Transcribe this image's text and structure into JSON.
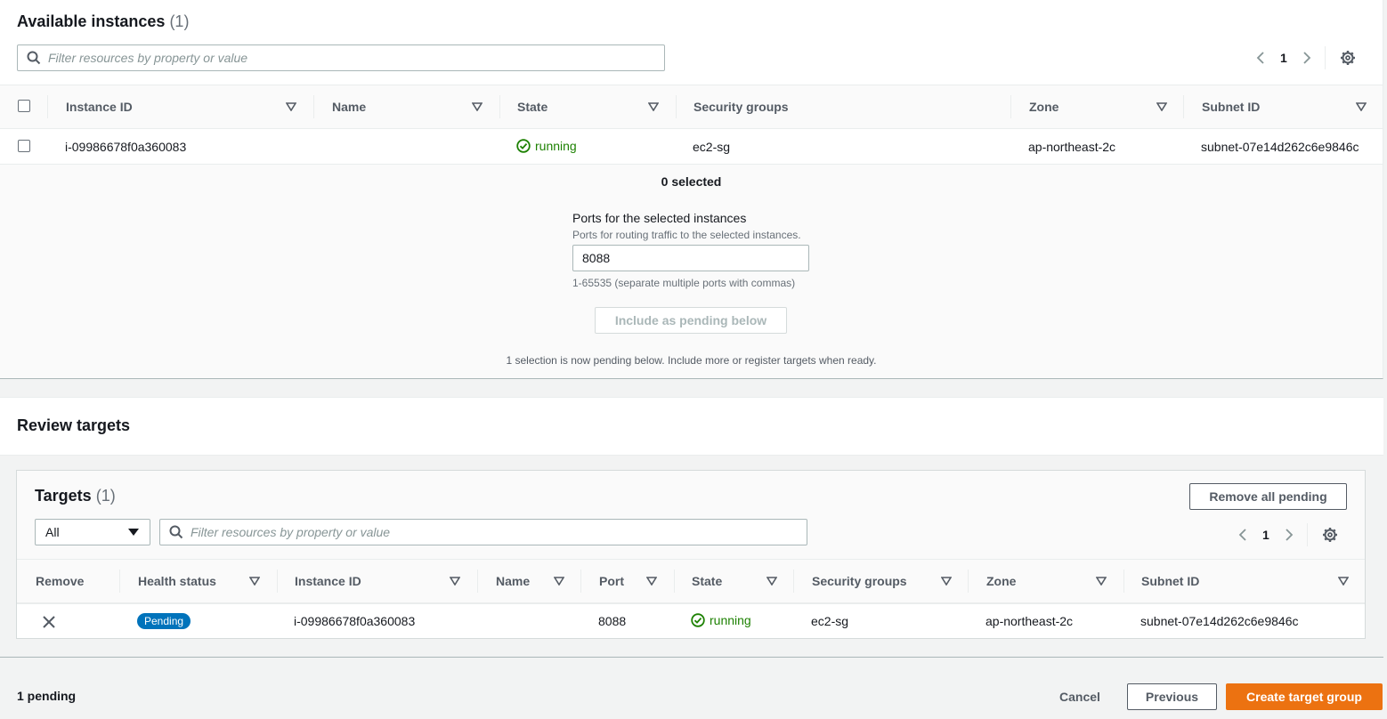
{
  "available": {
    "title": "Available instances",
    "count": "(1)",
    "search_placeholder": "Filter resources by property or value",
    "page": "1",
    "columns": [
      "Instance ID",
      "Name",
      "State",
      "Security groups",
      "Zone",
      "Subnet ID"
    ],
    "rows": [
      {
        "instance_id": "i-09986678f0a360083",
        "name": "",
        "state": "running",
        "security_groups": "ec2-sg",
        "zone": "ap-northeast-2c",
        "subnet_id": "subnet-07e14d262c6e9846c"
      }
    ],
    "selected_text": "0 selected",
    "ports_label": "Ports for the selected instances",
    "ports_desc": "Ports for routing traffic to the selected instances.",
    "ports_value": "8088",
    "ports_hint": "1-65535 (separate multiple ports with commas)",
    "include_button": "Include as pending below",
    "pending_note": "1 selection is now pending below. Include more or register targets when ready."
  },
  "review": {
    "title": "Review targets",
    "targets_title": "Targets",
    "targets_count": "(1)",
    "remove_all_button": "Remove all pending",
    "filter_select": "All",
    "search_placeholder": "Filter resources by property or value",
    "page": "1",
    "columns": [
      "Remove",
      "Health status",
      "Instance ID",
      "Name",
      "Port",
      "State",
      "Security groups",
      "Zone",
      "Subnet ID"
    ],
    "rows": [
      {
        "health": "Pending",
        "instance_id": "i-09986678f0a360083",
        "name": "",
        "port": "8088",
        "state": "running",
        "security_groups": "ec2-sg",
        "zone": "ap-northeast-2c",
        "subnet_id": "subnet-07e14d262c6e9846c"
      }
    ]
  },
  "footer": {
    "pending": "1 pending",
    "cancel": "Cancel",
    "previous": "Previous",
    "create": "Create target group"
  },
  "colors": {
    "primary": "#ec7211",
    "running": "#1d8102",
    "badge": "#0073bb"
  }
}
